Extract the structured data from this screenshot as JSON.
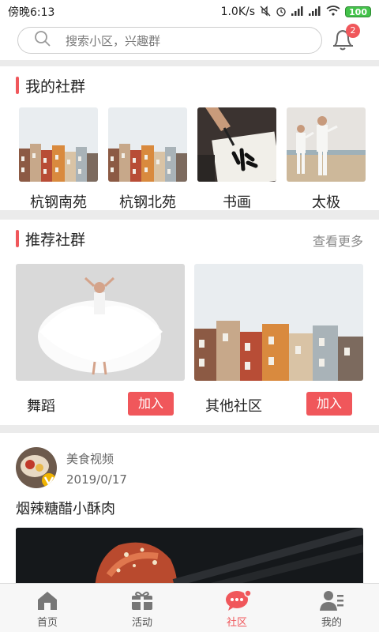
{
  "status_bar": {
    "time": "傍晚6:13",
    "speed": "1.0K/s",
    "battery": "100"
  },
  "search": {
    "placeholder": "搜索小区，兴趣群",
    "notification_count": "2"
  },
  "my_groups": {
    "title": "我的社群",
    "items": [
      {
        "name": "杭钢南苑",
        "icon": "townhouses-photo"
      },
      {
        "name": "杭钢北苑",
        "icon": "townhouses-photo"
      },
      {
        "name": "书画",
        "icon": "calligraphy-photo"
      },
      {
        "name": "太极",
        "icon": "taichi-photo"
      }
    ]
  },
  "recommended": {
    "title": "推荐社群",
    "more": "查看更多",
    "items": [
      {
        "name": "舞蹈",
        "join": "加入",
        "icon": "dancer-photo"
      },
      {
        "name": "其他社区",
        "join": "加入",
        "icon": "townhouses-photo"
      }
    ]
  },
  "post": {
    "source": "美食视频",
    "date": "2019/0/17",
    "title": "烟辣糖醋小酥肉",
    "avatar_icon": "food-avatar",
    "image_icon": "sweet-sour-pork-photo"
  },
  "tabs": [
    {
      "label": "首页",
      "icon": "home-icon"
    },
    {
      "label": "活动",
      "icon": "gift-icon"
    },
    {
      "label": "社区",
      "icon": "chat-bubble-icon"
    },
    {
      "label": "我的",
      "icon": "profile-icon"
    }
  ],
  "colors": {
    "accent": "#f0575b",
    "section_gap": "#ebebeb",
    "muted_text": "#8a8a8a"
  }
}
